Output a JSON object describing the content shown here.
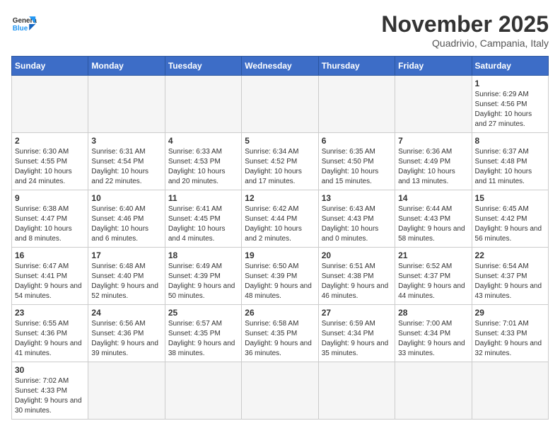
{
  "logo": {
    "text_general": "General",
    "text_blue": "Blue"
  },
  "title": "November 2025",
  "location": "Quadrivio, Campania, Italy",
  "weekdays": [
    "Sunday",
    "Monday",
    "Tuesday",
    "Wednesday",
    "Thursday",
    "Friday",
    "Saturday"
  ],
  "weeks": [
    [
      {
        "day": "",
        "info": ""
      },
      {
        "day": "",
        "info": ""
      },
      {
        "day": "",
        "info": ""
      },
      {
        "day": "",
        "info": ""
      },
      {
        "day": "",
        "info": ""
      },
      {
        "day": "",
        "info": ""
      },
      {
        "day": "1",
        "info": "Sunrise: 6:29 AM\nSunset: 4:56 PM\nDaylight: 10 hours and 27 minutes."
      }
    ],
    [
      {
        "day": "2",
        "info": "Sunrise: 6:30 AM\nSunset: 4:55 PM\nDaylight: 10 hours and 24 minutes."
      },
      {
        "day": "3",
        "info": "Sunrise: 6:31 AM\nSunset: 4:54 PM\nDaylight: 10 hours and 22 minutes."
      },
      {
        "day": "4",
        "info": "Sunrise: 6:33 AM\nSunset: 4:53 PM\nDaylight: 10 hours and 20 minutes."
      },
      {
        "day": "5",
        "info": "Sunrise: 6:34 AM\nSunset: 4:52 PM\nDaylight: 10 hours and 17 minutes."
      },
      {
        "day": "6",
        "info": "Sunrise: 6:35 AM\nSunset: 4:50 PM\nDaylight: 10 hours and 15 minutes."
      },
      {
        "day": "7",
        "info": "Sunrise: 6:36 AM\nSunset: 4:49 PM\nDaylight: 10 hours and 13 minutes."
      },
      {
        "day": "8",
        "info": "Sunrise: 6:37 AM\nSunset: 4:48 PM\nDaylight: 10 hours and 11 minutes."
      }
    ],
    [
      {
        "day": "9",
        "info": "Sunrise: 6:38 AM\nSunset: 4:47 PM\nDaylight: 10 hours and 8 minutes."
      },
      {
        "day": "10",
        "info": "Sunrise: 6:40 AM\nSunset: 4:46 PM\nDaylight: 10 hours and 6 minutes."
      },
      {
        "day": "11",
        "info": "Sunrise: 6:41 AM\nSunset: 4:45 PM\nDaylight: 10 hours and 4 minutes."
      },
      {
        "day": "12",
        "info": "Sunrise: 6:42 AM\nSunset: 4:44 PM\nDaylight: 10 hours and 2 minutes."
      },
      {
        "day": "13",
        "info": "Sunrise: 6:43 AM\nSunset: 4:43 PM\nDaylight: 10 hours and 0 minutes."
      },
      {
        "day": "14",
        "info": "Sunrise: 6:44 AM\nSunset: 4:43 PM\nDaylight: 9 hours and 58 minutes."
      },
      {
        "day": "15",
        "info": "Sunrise: 6:45 AM\nSunset: 4:42 PM\nDaylight: 9 hours and 56 minutes."
      }
    ],
    [
      {
        "day": "16",
        "info": "Sunrise: 6:47 AM\nSunset: 4:41 PM\nDaylight: 9 hours and 54 minutes."
      },
      {
        "day": "17",
        "info": "Sunrise: 6:48 AM\nSunset: 4:40 PM\nDaylight: 9 hours and 52 minutes."
      },
      {
        "day": "18",
        "info": "Sunrise: 6:49 AM\nSunset: 4:39 PM\nDaylight: 9 hours and 50 minutes."
      },
      {
        "day": "19",
        "info": "Sunrise: 6:50 AM\nSunset: 4:39 PM\nDaylight: 9 hours and 48 minutes."
      },
      {
        "day": "20",
        "info": "Sunrise: 6:51 AM\nSunset: 4:38 PM\nDaylight: 9 hours and 46 minutes."
      },
      {
        "day": "21",
        "info": "Sunrise: 6:52 AM\nSunset: 4:37 PM\nDaylight: 9 hours and 44 minutes."
      },
      {
        "day": "22",
        "info": "Sunrise: 6:54 AM\nSunset: 4:37 PM\nDaylight: 9 hours and 43 minutes."
      }
    ],
    [
      {
        "day": "23",
        "info": "Sunrise: 6:55 AM\nSunset: 4:36 PM\nDaylight: 9 hours and 41 minutes."
      },
      {
        "day": "24",
        "info": "Sunrise: 6:56 AM\nSunset: 4:36 PM\nDaylight: 9 hours and 39 minutes."
      },
      {
        "day": "25",
        "info": "Sunrise: 6:57 AM\nSunset: 4:35 PM\nDaylight: 9 hours and 38 minutes."
      },
      {
        "day": "26",
        "info": "Sunrise: 6:58 AM\nSunset: 4:35 PM\nDaylight: 9 hours and 36 minutes."
      },
      {
        "day": "27",
        "info": "Sunrise: 6:59 AM\nSunset: 4:34 PM\nDaylight: 9 hours and 35 minutes."
      },
      {
        "day": "28",
        "info": "Sunrise: 7:00 AM\nSunset: 4:34 PM\nDaylight: 9 hours and 33 minutes."
      },
      {
        "day": "29",
        "info": "Sunrise: 7:01 AM\nSunset: 4:33 PM\nDaylight: 9 hours and 32 minutes."
      }
    ],
    [
      {
        "day": "30",
        "info": "Sunrise: 7:02 AM\nSunset: 4:33 PM\nDaylight: 9 hours and 30 minutes."
      },
      {
        "day": "",
        "info": ""
      },
      {
        "day": "",
        "info": ""
      },
      {
        "day": "",
        "info": ""
      },
      {
        "day": "",
        "info": ""
      },
      {
        "day": "",
        "info": ""
      },
      {
        "day": "",
        "info": ""
      }
    ]
  ]
}
